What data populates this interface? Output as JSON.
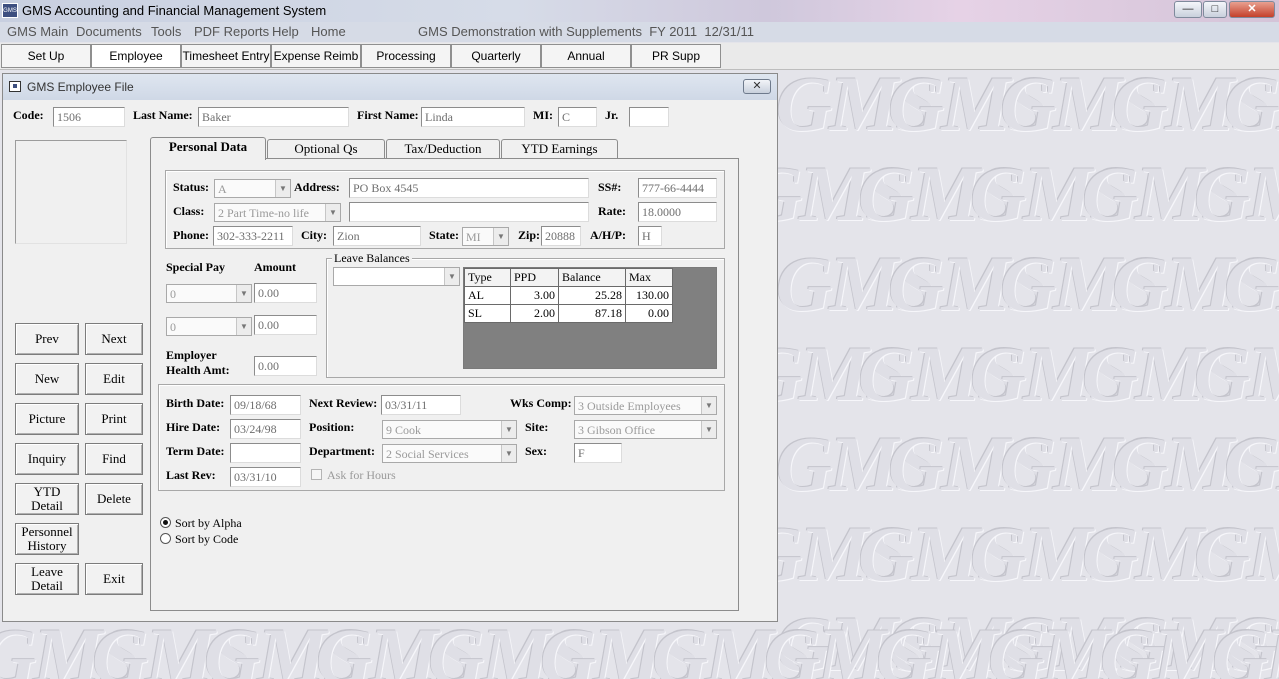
{
  "window": {
    "app_icon": "GMS",
    "title": "GMS Accounting and Financial Management System",
    "buttons": {
      "minimize": "—",
      "maximize": "□",
      "close": "✕"
    }
  },
  "menubar": {
    "items": [
      "GMS Main",
      "Documents",
      "Tools",
      "PDF Reports",
      "Help",
      "Home"
    ],
    "status": "GMS Demonstration with Supplements  FY 2011  12/31/11"
  },
  "toolbar": {
    "buttons": [
      "Set Up",
      "Employee",
      "Timesheet Entry",
      "Expense Reimb",
      "Processing",
      "Quarterly",
      "Annual",
      "PR Supp"
    ],
    "active": "Employee"
  },
  "watermark_text": "GMS",
  "dialog": {
    "title": "GMS Employee File",
    "close_label": "✕",
    "header": {
      "code_label": "Code:",
      "code": "1506",
      "last_name_label": "Last Name:",
      "last_name": "Baker",
      "first_name_label": "First Name:",
      "first_name": "Linda",
      "mi_label": "MI:",
      "mi": "C",
      "jr_label": "Jr.",
      "jr": ""
    },
    "side_buttons": {
      "prev": "Prev",
      "next": "Next",
      "new": "New",
      "edit": "Edit",
      "picture": "Picture",
      "print": "Print",
      "inquiry": "Inquiry",
      "find": "Find",
      "ytd_detail_1": "YTD",
      "ytd_detail_2": "Detail",
      "delete": "Delete",
      "personnel_history_1": "Personnel",
      "personnel_history_2": "History",
      "leave_detail_1": "Leave",
      "leave_detail_2": "Detail",
      "exit": "Exit"
    },
    "tabs": [
      "Personal Data",
      "Optional Qs",
      "Tax/Deduction",
      "YTD Earnings"
    ],
    "personal": {
      "status_label": "Status:",
      "status": "A",
      "address_label": "Address:",
      "address1": "PO Box 4545",
      "address2": "",
      "ssn_label": "SS#:",
      "ssn": "777-66-4444",
      "class_label": "Class:",
      "class": "2 Part Time-no life",
      "rate_label": "Rate:",
      "rate": "18.0000",
      "phone_label": "Phone:",
      "phone": "302-333-2211",
      "city_label": "City:",
      "city": "Zion",
      "state_label": "State:",
      "state": "MI",
      "zip_label": "Zip:",
      "zip": "20888",
      "ahp_label": "A/H/P:",
      "ahp": "H"
    },
    "special_pay": {
      "special_pay_label": "Special Pay",
      "amount_label": "Amount",
      "pay1": "0",
      "amt1": "0.00",
      "pay2": "0",
      "amt2": "0.00",
      "employer_health_label_1": "Employer",
      "employer_health_label_2": "Health Amt:",
      "employer_health_amt": "0.00"
    },
    "leave_balances": {
      "legend": "Leave Balances",
      "dropdown": "",
      "headers": [
        "Type",
        "PPD",
        "Balance",
        "Max"
      ],
      "rows": [
        {
          "type": "AL",
          "ppd": "3.00",
          "balance": "25.28",
          "max": "130.00"
        },
        {
          "type": "SL",
          "ppd": "2.00",
          "balance": "87.18",
          "max": "0.00"
        }
      ]
    },
    "employment": {
      "birth_date_label": "Birth Date:",
      "birth_date": "09/18/68",
      "next_review_label": "Next Review:",
      "next_review": "03/31/11",
      "wks_comp_label": "Wks Comp:",
      "wks_comp": "3 Outside Employees",
      "hire_date_label": "Hire Date:",
      "hire_date": "03/24/98",
      "position_label": "Position:",
      "position": "9 Cook",
      "site_label": "Site:",
      "site": "3 Gibson Office",
      "term_date_label": "Term Date:",
      "term_date": "",
      "department_label": "Department:",
      "department": "2 Social Services",
      "sex_label": "Sex:",
      "sex": "F",
      "last_rev_label": "Last Rev:",
      "last_rev": "03/31/10",
      "ask_for_hours_label": "Ask for Hours"
    },
    "sort": {
      "alpha_label": "Sort by Alpha",
      "code_label": "Sort by Code",
      "selected": "alpha"
    }
  }
}
